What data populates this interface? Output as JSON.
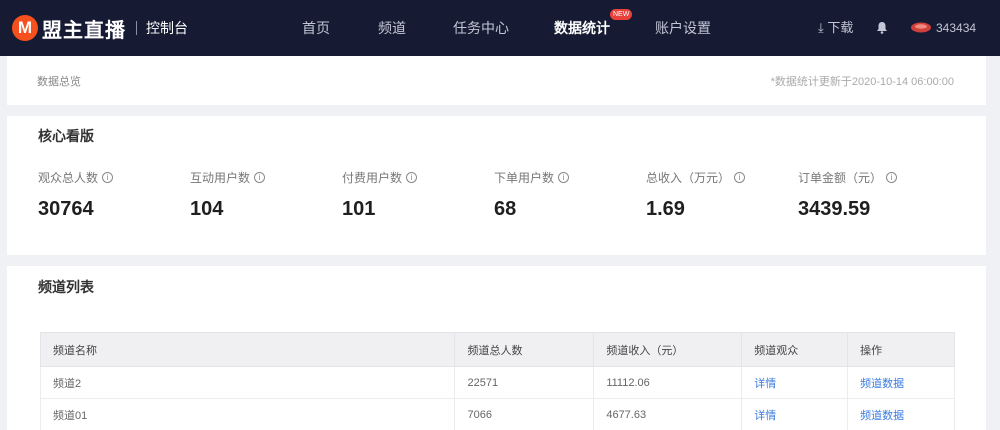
{
  "header": {
    "brand": "盟主直播",
    "brand_mark": "M",
    "subtitle": "控制台",
    "nav": [
      {
        "label": "首页"
      },
      {
        "label": "频道"
      },
      {
        "label": "任务中心"
      },
      {
        "label": "数据统计",
        "active": true,
        "badge": "NEW"
      },
      {
        "label": "账户设置"
      }
    ],
    "download_label": "下载",
    "user_name": "343434"
  },
  "overview": {
    "breadcrumb": "数据总览",
    "update_note": "*数据统计更新于2020-10-14 06:00:00"
  },
  "core": {
    "title": "核心看版",
    "metrics": [
      {
        "label": "观众总人数",
        "value": "30764"
      },
      {
        "label": "互动用户数",
        "value": "104"
      },
      {
        "label": "付费用户数",
        "value": "101"
      },
      {
        "label": "下单用户数",
        "value": "68"
      },
      {
        "label": "总收入（万元）",
        "value": "1.69"
      },
      {
        "label": "订单金额（元）",
        "value": "3439.59"
      }
    ]
  },
  "channels": {
    "title": "频道列表",
    "columns": [
      "频道名称",
      "频道总人数",
      "频道收入（元）",
      "频道观众",
      "操作"
    ],
    "rows": [
      [
        "频道2",
        "22571",
        "11112.06",
        "详情",
        "频道数据"
      ],
      [
        "频道01",
        "7066",
        "4677.63",
        "详情",
        "频道数据"
      ]
    ]
  },
  "colors": {
    "topbar": "#161b33",
    "brand": "#f5501e",
    "badge": "#e8413a",
    "link": "#3a7be0"
  }
}
